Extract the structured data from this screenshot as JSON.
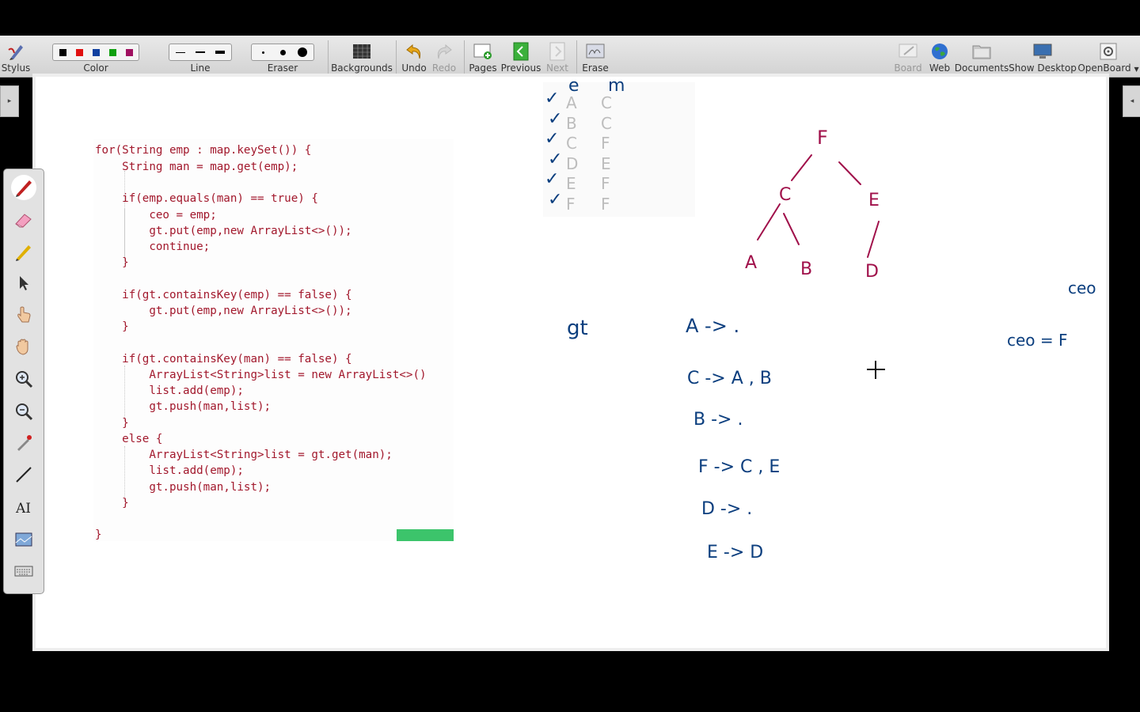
{
  "toolbar": {
    "stylus": "Stylus",
    "color": "Color",
    "line": "Line",
    "eraser": "Eraser",
    "backgrounds": "Backgrounds",
    "undo": "Undo",
    "redo": "Redo",
    "pages": "Pages",
    "previous": "Previous",
    "next": "Next",
    "erase": "Erase",
    "board": "Board",
    "web": "Web",
    "documents": "Documents",
    "show_desktop": "Show Desktop",
    "openboard": "OpenBoard"
  },
  "colors": {
    "black": "#000000",
    "red": "#e01010",
    "blue": "#1040a0",
    "green": "#10a010",
    "magenta": "#a01060",
    "ink_blue": "#0b3e7e",
    "ink_red": "#a0104a"
  },
  "code": {
    "l1": "for(String emp : map.keySet()) {",
    "l2": "    String man = map.get(emp);",
    "l3": "    if(emp.equals(man) == true) {",
    "l4": "        ceo = emp;",
    "l5": "        gt.put(emp,new ArrayList<>());",
    "l6": "        continue;",
    "l7": "    }",
    "l8": "    if(gt.containsKey(emp) == false) {",
    "l9": "        gt.put(emp,new ArrayList<>());",
    "l10": "    }",
    "l11": "    if(gt.containsKey(man) == false) {",
    "l12": "        ArrayList<String>list = new ArrayList<>()",
    "l13": "        list.add(emp);",
    "l14": "        gt.push(man,list);",
    "l15": "    }",
    "l16": "    else {",
    "l17": "        ArrayList<String>list = gt.get(man);",
    "l18": "        list.add(emp);",
    "l19": "        gt.push(man,list);",
    "l20": "    }",
    "l21": "}"
  },
  "table": {
    "headers": [
      "e",
      "m"
    ],
    "rows": [
      [
        "A",
        "C"
      ],
      [
        "B",
        "C"
      ],
      [
        "C",
        "F"
      ],
      [
        "D",
        "E"
      ],
      [
        "E",
        "F"
      ],
      [
        "F",
        "F"
      ]
    ],
    "check": "✓"
  },
  "tree": {
    "root": "F",
    "n1": "C",
    "n2": "E",
    "leaf1": "A",
    "leaf2": "B",
    "leaf3": "D"
  },
  "notes": {
    "gt": "gt",
    "m1": "A -> .",
    "m2": "C -> A , B",
    "m3": "B -> .",
    "m4": "F -> C , E",
    "m5": "D -> .",
    "m6": "E -> D",
    "ceo": "ceo",
    "ceo_eq": "ceo = F"
  }
}
